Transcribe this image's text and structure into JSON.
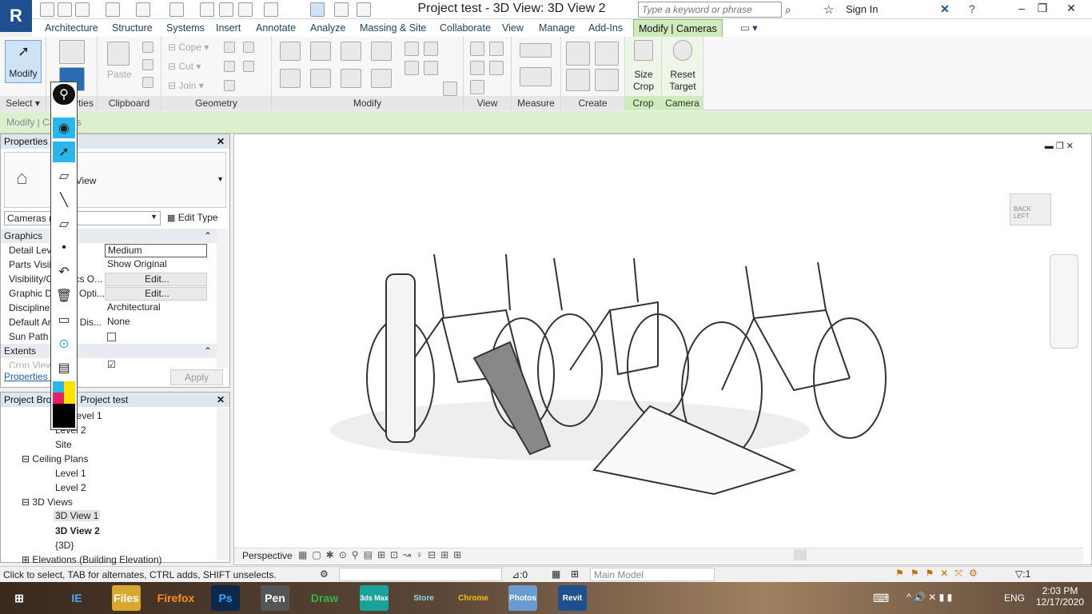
{
  "app": {
    "title": "Project test - 3D View: 3D View 2",
    "search_placeholder": "Type a keyword or phrase",
    "sign_in": "Sign In",
    "logo": "R"
  },
  "ribbon_tabs": [
    "Architecture",
    "Structure",
    "Systems",
    "Insert",
    "Annotate",
    "Analyze",
    "Massing & Site",
    "Collaborate",
    "View",
    "Manage",
    "Add-Ins",
    "Modify | Cameras"
  ],
  "ribbon": {
    "modify_label": "Modify",
    "select_label": "Select",
    "properties_label": "Properties",
    "clipboard_label": "Clipboard",
    "paste_label": "Paste",
    "geometry_label": "Geometry",
    "cope_label": "Cope",
    "cut_label": "Cut",
    "join_label": "Join",
    "modify_panel_label": "Modify",
    "view_label": "View",
    "measure_label": "Measure",
    "create_label": "Create",
    "crop_label": "Crop",
    "size_crop_label": "Size Crop",
    "camera_label": "Camera",
    "reset_target_label": "Reset Target"
  },
  "options_bar": "Modify | Cameras",
  "properties": {
    "title": "Properties",
    "type_name": "3D View",
    "selector": "Cameras (1)",
    "edit_type": "Edit Type",
    "group_graphics": "Graphics",
    "rows": [
      {
        "k": "Detail Level",
        "v": "Medium"
      },
      {
        "k": "Parts Visibility",
        "v": "Show Original"
      },
      {
        "k": "Visibility/Graphics O...",
        "v": "Edit..."
      },
      {
        "k": "Graphic Display Opti...",
        "v": "Edit..."
      },
      {
        "k": "Discipline",
        "v": "Architectural"
      },
      {
        "k": "Default Analysis Dis...",
        "v": "None"
      },
      {
        "k": "Sun Path",
        "v": ""
      }
    ],
    "group_extents": "Extents",
    "crop_view": "Crop View",
    "help_link": "Properties help",
    "apply": "Apply"
  },
  "browser": {
    "title": "Project Browser - Project test",
    "items": [
      {
        "label": "Level 1",
        "indent": 3
      },
      {
        "label": "Level 2",
        "indent": 3
      },
      {
        "label": "Site",
        "indent": 3
      },
      {
        "label": "Ceiling Plans",
        "indent": 2
      },
      {
        "label": "Level 1",
        "indent": 3
      },
      {
        "label": "Level 2",
        "indent": 3
      },
      {
        "label": "3D Views",
        "indent": 2
      },
      {
        "label": "3D View 1",
        "indent": 3
      },
      {
        "label": "3D View 2",
        "indent": 3
      },
      {
        "label": "{3D}",
        "indent": 3
      },
      {
        "label": "Elevations (Building Elevation)",
        "indent": 2
      }
    ]
  },
  "viewcube": {
    "back": "BACK",
    "left": "LEFT"
  },
  "view_control": {
    "mode": "Perspective"
  },
  "status": {
    "hint": "Click to select, TAB for alternates, CTRL adds, SHIFT unselects.",
    "count": ":0",
    "model": "Main Model",
    "filter": ":1"
  },
  "taskbar": {
    "time": "2:03 PM",
    "date": "12/17/2020",
    "lang": "ENG",
    "apps": [
      "IE",
      "Files",
      "Firefox",
      "Ps",
      "Pen",
      "Draw",
      "3ds Max",
      "Store",
      "Chrome",
      "Photos",
      "Revit"
    ]
  }
}
